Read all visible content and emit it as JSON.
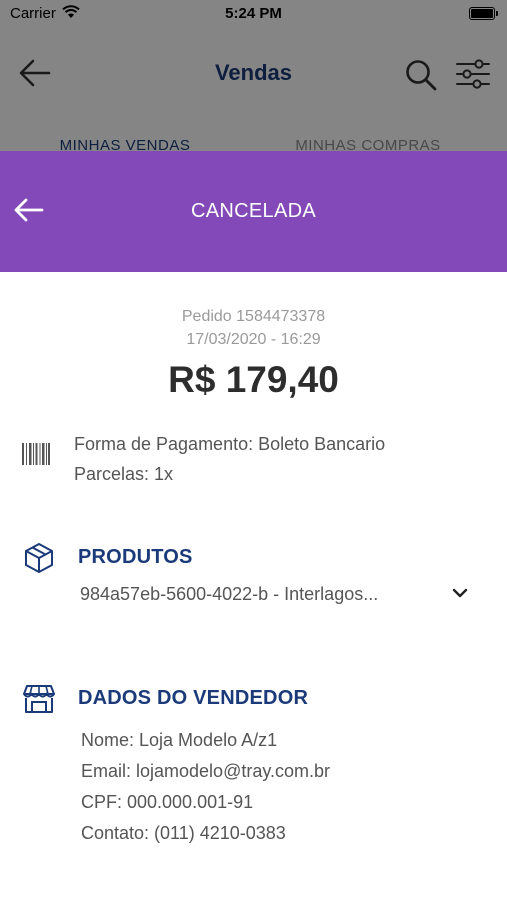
{
  "status_bar": {
    "carrier": "Carrier",
    "time": "5:24 PM"
  },
  "background_screen": {
    "title": "Vendas",
    "tabs": [
      {
        "label": "MINHAS VENDAS"
      },
      {
        "label": "MINHAS COMPRAS"
      }
    ]
  },
  "sheet": {
    "header_color": "#8449b9",
    "title": "CANCELADA",
    "order": {
      "id_label": "Pedido 1584473378",
      "date": "17/03/2020 - 16:29",
      "total": "R$ 179,40"
    },
    "payment": {
      "method": "Forma de Pagamento: Boleto Bancario",
      "installments": "Parcelas: 1x"
    },
    "products": {
      "title": "PRODUTOS",
      "item": "984a57eb-5600-4022-b - Interlagos..."
    },
    "seller": {
      "title": "DADOS DO VENDEDOR",
      "name": "Nome: Loja Modelo A/z1",
      "email": "Email: lojamodelo@tray.com.br",
      "cpf": "CPF: 000.000.001-91",
      "contact": "Contato: (011) 4210-0383"
    }
  }
}
